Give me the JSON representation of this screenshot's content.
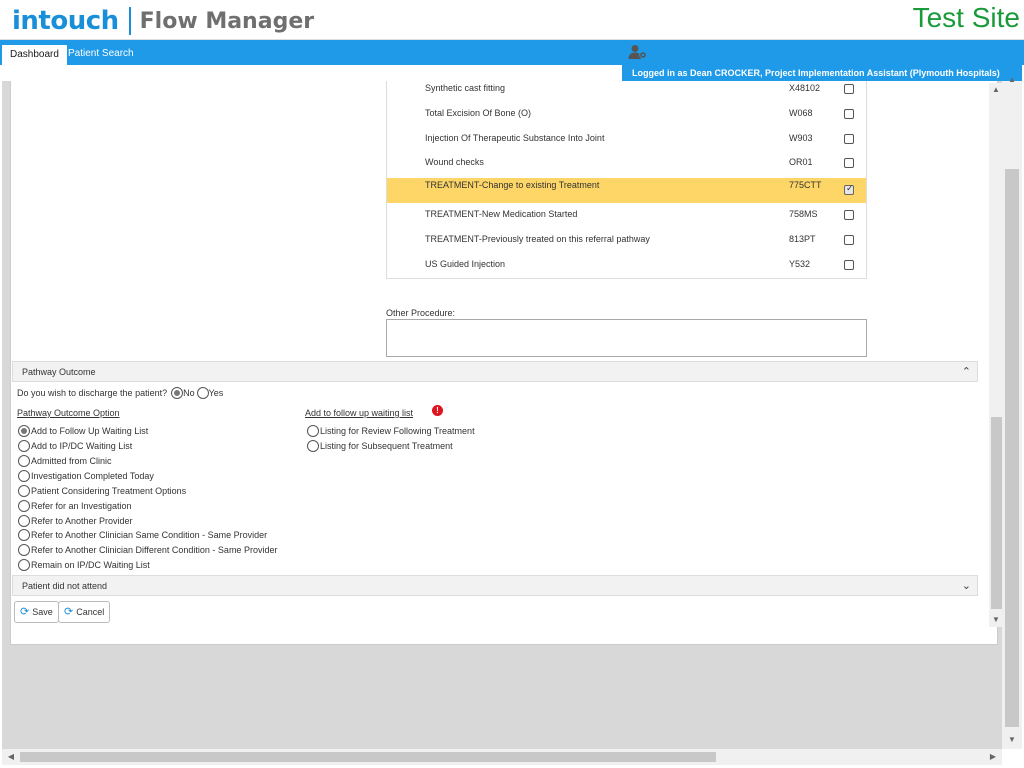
{
  "header": {
    "logo_brand": "intouch",
    "logo_product": "Flow Manager",
    "site_label": "Test Site"
  },
  "nav": {
    "tabs": [
      {
        "label": "Dashboard",
        "active": true
      },
      {
        "label": "Patient Search",
        "active": false
      }
    ],
    "user_text": "Logged in as Dean CROCKER, Project Implementation Assistant (Plymouth Hospitals)",
    "user_icon": "user-settings-icon"
  },
  "procedures": [
    {
      "name": "Synthetic cast fitting",
      "code": "X48102",
      "checked": false
    },
    {
      "name": "Total Excision Of Bone (O)",
      "code": "W068",
      "checked": false
    },
    {
      "name": "Injection Of Therapeutic Substance Into Joint",
      "code": "W903",
      "checked": false
    },
    {
      "name": "Wound checks",
      "code": "OR01",
      "checked": false
    },
    {
      "name": "TREATMENT-Change to existing Treatment",
      "code": "775CTT",
      "checked": true
    },
    {
      "name": "TREATMENT-New Medication Started",
      "code": "758MS",
      "checked": false
    },
    {
      "name": "TREATMENT-Previously treated on this referral pathway",
      "code": "813PT",
      "checked": false
    },
    {
      "name": "US Guided Injection",
      "code": "Y532",
      "checked": false
    }
  ],
  "other_procedure": {
    "label": "Other Procedure:",
    "value": ""
  },
  "pathway_outcome": {
    "section_title": "Pathway Outcome",
    "discharge_question": "Do you wish to discharge the patient?",
    "discharge_options": [
      {
        "label": "No",
        "selected": true
      },
      {
        "label": "Yes",
        "selected": false
      }
    ],
    "options_heading": "Pathway Outcome Option",
    "options": [
      {
        "label": "Add to Follow Up Waiting List",
        "selected": true
      },
      {
        "label": "Add to IP/DC Waiting List",
        "selected": false
      },
      {
        "label": "Admitted from Clinic",
        "selected": false
      },
      {
        "label": "Investigation Completed Today",
        "selected": false
      },
      {
        "label": "Patient Considering Treatment Options",
        "selected": false
      },
      {
        "label": "Refer for an Investigation",
        "selected": false
      },
      {
        "label": "Refer to Another Provider",
        "selected": false
      },
      {
        "label": "Refer to Another Clinician Same Condition - Same Provider",
        "selected": false
      },
      {
        "label": "Refer to Another Clinician Different Condition - Same Provider",
        "selected": false
      },
      {
        "label": "Remain on IP/DC Waiting List",
        "selected": false
      }
    ],
    "followup_heading": "Add to follow up waiting list",
    "followup_error_icon": "exclamation-error-icon",
    "followup_options": [
      {
        "label": "Listing for Review Following Treatment",
        "selected": false
      },
      {
        "label": "Listing for Subsequent Treatment",
        "selected": false
      }
    ]
  },
  "dna_section": {
    "title": "Patient did not attend"
  },
  "buttons": {
    "save": "Save",
    "cancel": "Cancel"
  },
  "colors": {
    "brand_blue": "#1e9ae8",
    "site_green": "#1a9a3a",
    "highlight_row": "#fdd667",
    "error_red": "#e0141e"
  }
}
